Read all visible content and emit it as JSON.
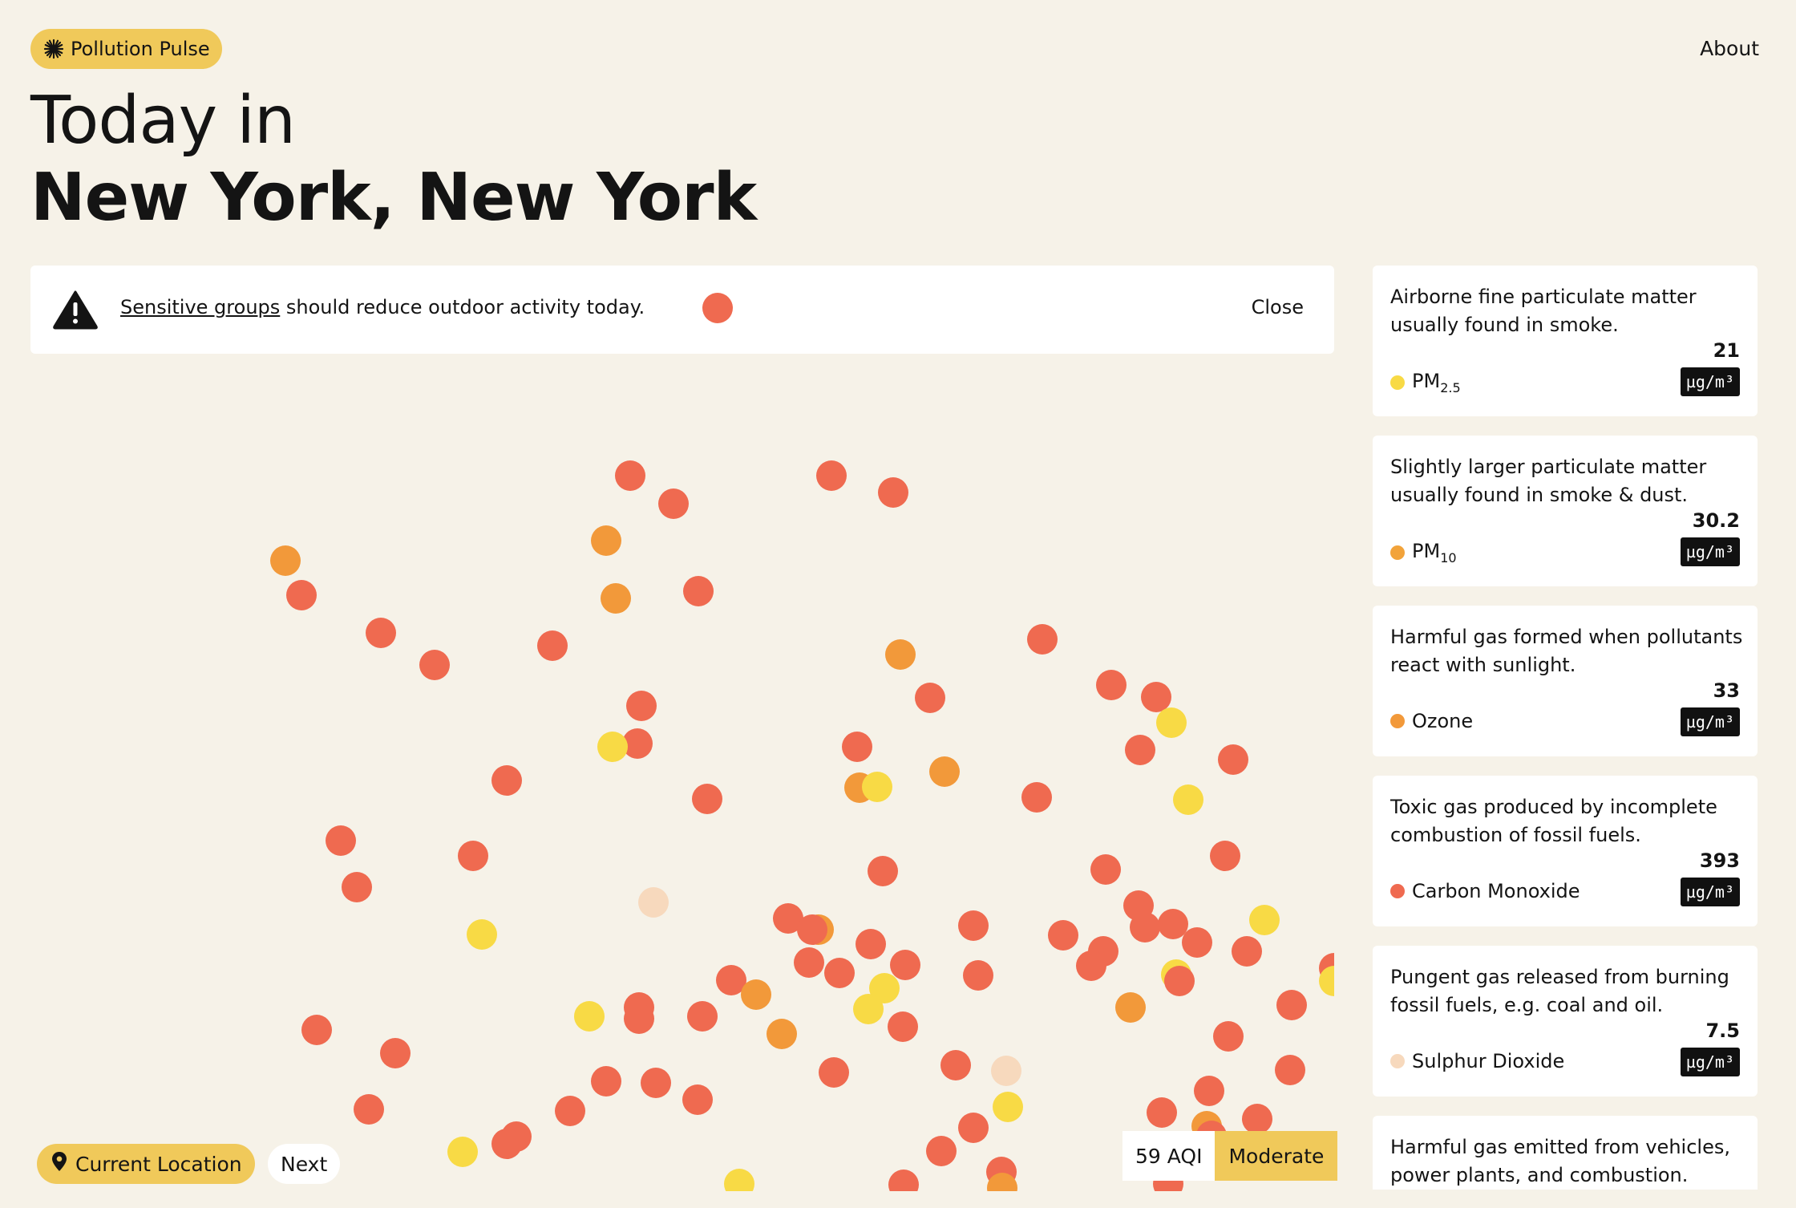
{
  "app": {
    "brand": "Pollution Pulse",
    "about_label": "About"
  },
  "header": {
    "title_line1": "Today in",
    "title_line2": "New York, New York"
  },
  "alert": {
    "link_text": "Sensitive groups",
    "message": " should reduce outdoor activity today.",
    "close_label": "Close"
  },
  "controls": {
    "current_location_label": "Current Location",
    "next_label": "Next"
  },
  "aqi": {
    "value": "59 AQI",
    "category": "Moderate"
  },
  "colors": {
    "background": "#f6f2e8",
    "accent": "#f0c95a",
    "red": "#ef6a50",
    "orange": "#f2993a",
    "yellow": "#f8da45",
    "peach": "#f7d9bd"
  },
  "pollutants": [
    {
      "description": "Airborne fine particulate matter usually found in smoke.",
      "name": "PM",
      "subscript": "2.5",
      "value": "21",
      "unit": "µg/m³",
      "color": "#f8da45"
    },
    {
      "description": "Slightly larger particulate matter usually found in smoke & dust.",
      "name": "PM",
      "subscript": "10",
      "value": "30.2",
      "unit": "µg/m³",
      "color": "#f2a33a"
    },
    {
      "description": "Harmful gas formed when pollutants react with sunlight.",
      "name": "Ozone",
      "subscript": "",
      "value": "33",
      "unit": "µg/m³",
      "color": "#f2993a"
    },
    {
      "description": "Toxic gas produced by incomplete combustion of fossil fuels.",
      "name": "Carbon Monoxide",
      "subscript": "",
      "value": "393",
      "unit": "µg/m³",
      "color": "#ef6a50"
    },
    {
      "description": "Pungent gas released from burning fossil fuels, e.g. coal and oil.",
      "name": "Sulphur Dioxide",
      "subscript": "",
      "value": "7.5",
      "unit": "µg/m³",
      "color": "#f7d9bd"
    },
    {
      "description": "Harmful gas emitted from vehicles, power plants, and combustion.",
      "name": "",
      "subscript": "",
      "value": "",
      "unit": "",
      "color": ""
    }
  ]
}
